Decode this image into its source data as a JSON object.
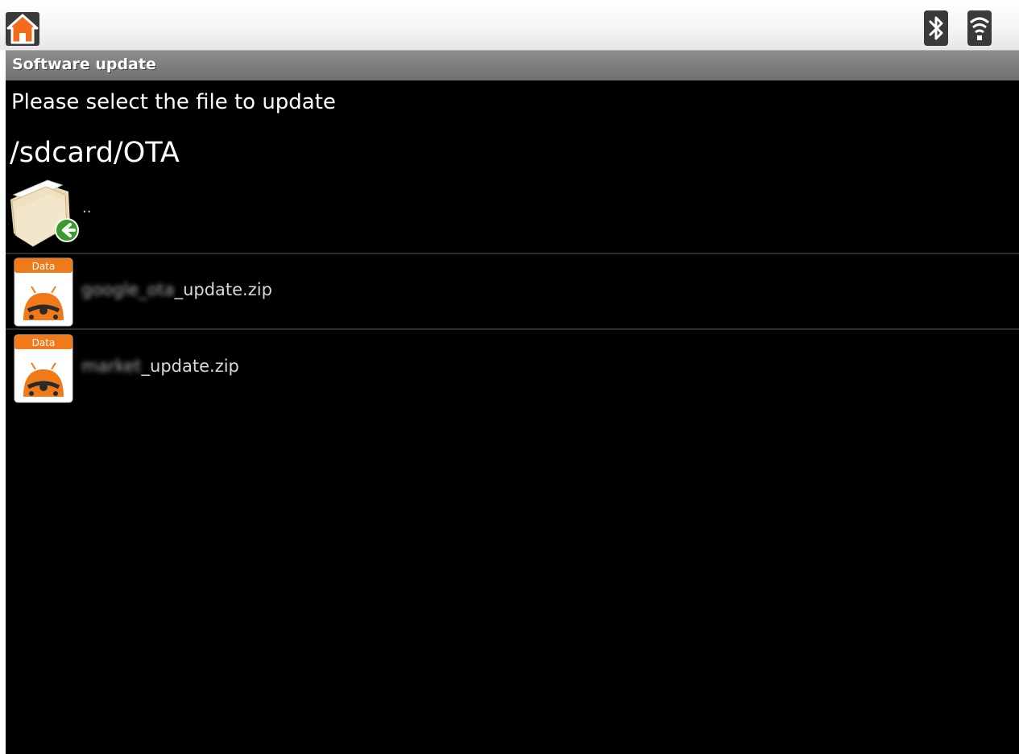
{
  "status_bar": {
    "home_icon": "home-icon",
    "bluetooth_icon": "bluetooth-icon",
    "wifi_icon": "wifi-icon"
  },
  "title_bar": {
    "title": "Software update"
  },
  "content": {
    "prompt": "Please select the file to update",
    "path": "/sdcard/OTA",
    "parent_entry": {
      "label": "..",
      "icon": "folder-up-icon"
    },
    "files": [
      {
        "name_prefix": "google_ota",
        "name_suffix": "_update.zip",
        "icon_label": "Data"
      },
      {
        "name_prefix": "market",
        "name_suffix": "_update.zip",
        "icon_label": "Data"
      }
    ]
  },
  "colors": {
    "background": "#000000",
    "title_bar": "#7c7c7c",
    "file_icon_header": "#f07a1a",
    "status_bar": "#f2f2f2"
  }
}
